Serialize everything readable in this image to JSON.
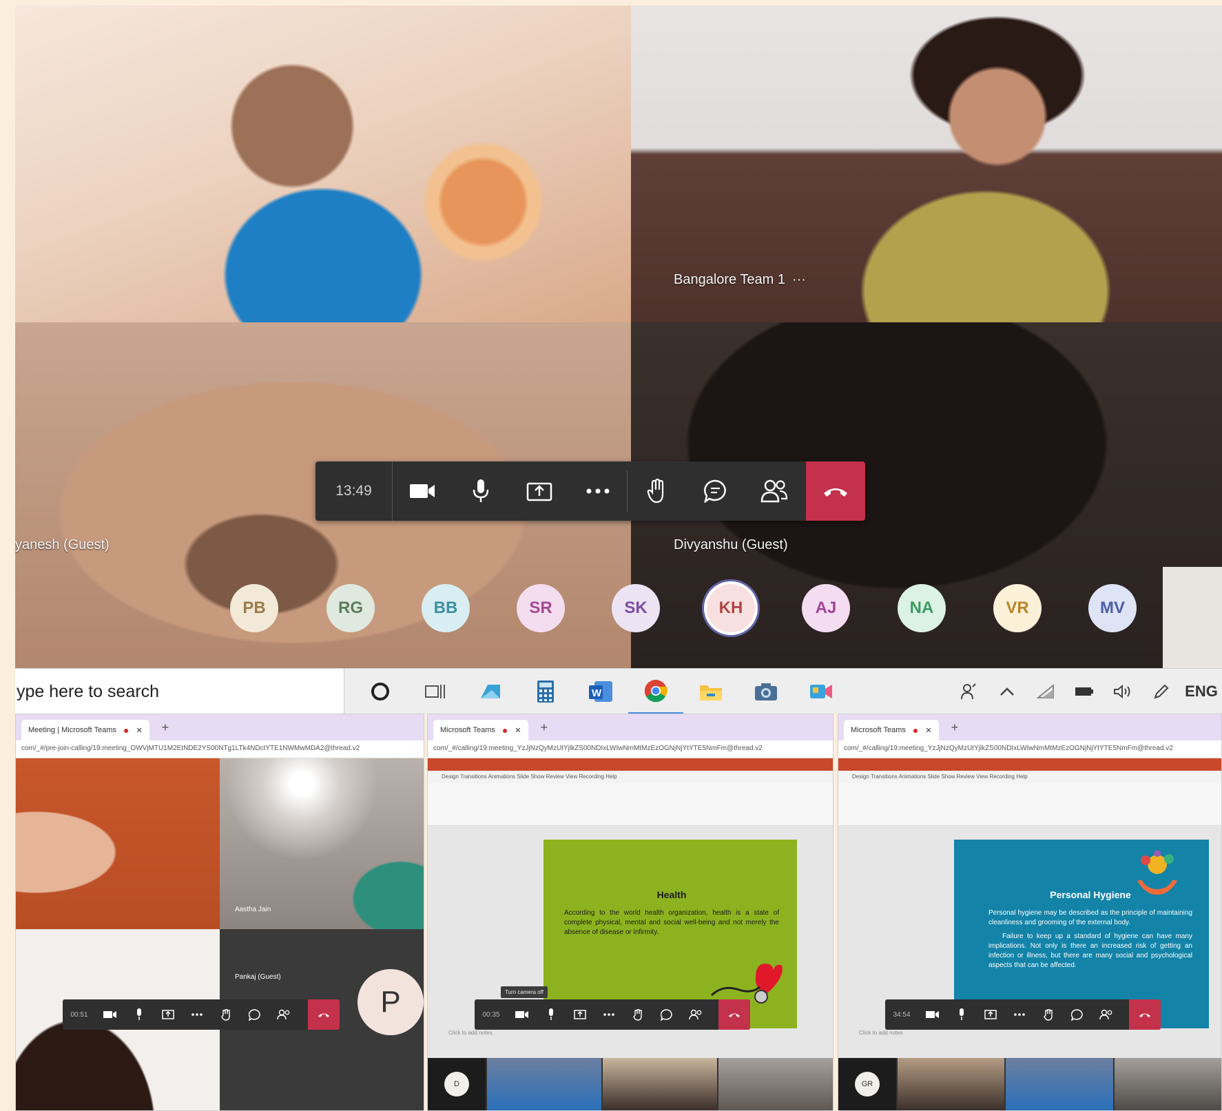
{
  "meeting": {
    "tiles": [
      {
        "label": ""
      },
      {
        "label": "Bangalore Team 1",
        "more": "···"
      },
      {
        "label": "yanesh (Guest)"
      },
      {
        "label": "Divyanshu (Guest)"
      }
    ],
    "call_bar": {
      "timer": "13:49"
    },
    "avatars": [
      {
        "initials": "PB",
        "bg": "#f3e9d8",
        "fg": "#9b7c4c"
      },
      {
        "initials": "RG",
        "bg": "#dfe9df",
        "fg": "#5d7d5d"
      },
      {
        "initials": "BB",
        "bg": "#d8eef3",
        "fg": "#3e8fa3"
      },
      {
        "initials": "SR",
        "bg": "#f5ddf0",
        "fg": "#a34a8f"
      },
      {
        "initials": "SK",
        "bg": "#ece3f3",
        "fg": "#7d4ea3"
      },
      {
        "initials": "KH",
        "bg": "#f9e0e0",
        "fg": "#b04545"
      },
      {
        "initials": "AJ",
        "bg": "#f4ddf1",
        "fg": "#a0459a"
      },
      {
        "initials": "NA",
        "bg": "#dcf2e4",
        "fg": "#3d9a63"
      },
      {
        "initials": "VR",
        "bg": "#fcf0d8",
        "fg": "#b8862a"
      },
      {
        "initials": "MV",
        "bg": "#dee4f5",
        "fg": "#4c5ea8"
      }
    ]
  },
  "taskbar": {
    "search_text": "ype here to search",
    "language": "ENG"
  },
  "panels": [
    {
      "tab_title": "Meeting | Microsoft Teams",
      "url": "com/_#/pre-join-calling/19:meeting_OWVjMTU1M2EtNDE2YS00NTg1LTk4NDctYTE1NWMwMDA2@thread.v2",
      "timer": "00:51",
      "participant_label": "Aastha Jain",
      "guest_label": "Pankaj (Guest)",
      "big_avatar": "P"
    },
    {
      "tab_title": "Microsoft Teams",
      "url": "com/_#/calling/19:meeting_YzJjNzQyMzUtYjlkZS00NDIxLWIwNmMtMzEzOGNjNjYtYTE5NmFm@thread.v2",
      "ribbon_tabs": "Design   Transitions   Animations   Slide Show   Review   View   Recording   Help",
      "slide_title": "Health",
      "slide_body": "According to the world health organization, health is a state of complete physical, mental and social well-being and not merely the absence of disease or infirmity.",
      "tooltip": "Turn camera off",
      "timer": "00:35",
      "notes": "Click to add notes",
      "avatar": "D"
    },
    {
      "tab_title": "Microsoft Teams",
      "url": "com/_#/calling/19:meeting_YzJjNzQyMzUtYjlkZS00NDIxLWIwNmMtMzEzOGNjNjYtYTE5NmFm@thread.v2",
      "ribbon_tabs": "Design   Transitions   Animations   Slide Show   Review   View   Recording   Help",
      "slide_title": "Personal Hygiene",
      "slide_body_1": "Personal hygiene may be described as the principle of maintaining cleanliness and grooming of the external body.",
      "slide_body_2": "Failure to keep up a standard of hygiene can have many implications. Not only is there an increased risk of getting an infection or illness, but there are many social and psychological aspects that can be affected.",
      "timer": "34:54",
      "notes": "Click to add notes",
      "avatar": "GR"
    }
  ],
  "colors": {
    "hangup": "#c4314b",
    "teams_purple": "#6264a7",
    "ppt_orange": "#c9482b",
    "slide_green": "#8cb31f",
    "slide_blue": "#1383a8"
  }
}
